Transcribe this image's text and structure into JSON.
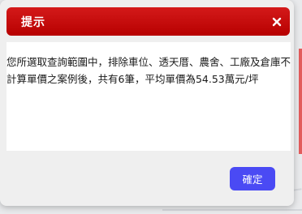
{
  "dialog": {
    "title": "提示",
    "close_icon": "close-icon",
    "message": "您所選取查詢範圍中，排除車位、透天厝、農舍、工廠及倉庫不計算單價之案例後，共有6筆，平均單價為54.53萬元/坪",
    "ok_label": "確定",
    "colors": {
      "titlebar": "#c40d0d",
      "button": "#4a4af4"
    }
  }
}
